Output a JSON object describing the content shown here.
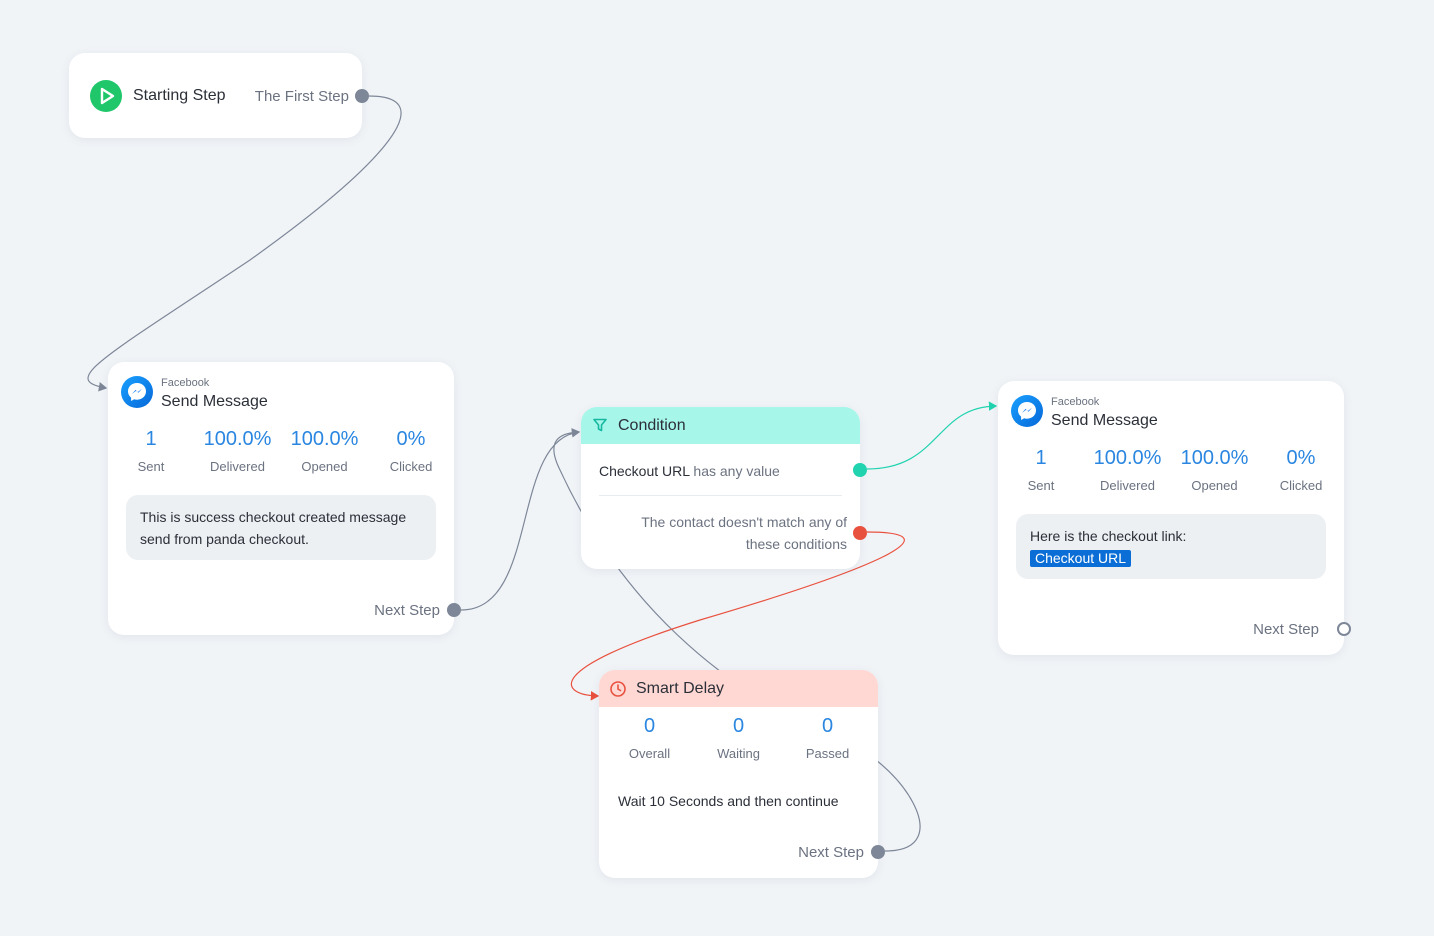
{
  "colors": {
    "canvas": "#f1f4f7",
    "stat_blue": "#2a86e0",
    "wire_gray": "#7d8798",
    "wire_green": "#22d3b0",
    "wire_red": "#e9513f",
    "condition_header": "#a6f6ea",
    "delay_header": "#ffd8d4",
    "start_icon": "#1fc76a",
    "link_chip": "#0a6ed6"
  },
  "start_step": {
    "icon": "play-icon",
    "title": "Starting Step",
    "next_label": "The First Step"
  },
  "message_1": {
    "icon": "messenger-icon",
    "platform": "Facebook",
    "title": "Send Message",
    "stats": [
      {
        "value": "1",
        "label": "Sent"
      },
      {
        "value": "100.0%",
        "label": "Delivered"
      },
      {
        "value": "100.0%",
        "label": "Opened"
      },
      {
        "value": "0%",
        "label": "Clicked"
      }
    ],
    "body": "This is success checkout created message send from panda checkout.",
    "next_label": "Next Step"
  },
  "condition": {
    "icon": "filter-icon",
    "title": "Condition",
    "field": "Checkout URL",
    "operator": "has any value",
    "fallback": "The contact doesn't match any of these conditions"
  },
  "delay": {
    "icon": "clock-icon",
    "title": "Smart Delay",
    "stats": [
      {
        "value": "0",
        "label": "Overall"
      },
      {
        "value": "0",
        "label": "Waiting"
      },
      {
        "value": "0",
        "label": "Passed"
      }
    ],
    "desc_prefix": "Wait",
    "desc_amount": "10 Seconds",
    "desc_suffix": "and then continue",
    "next_label": "Next Step"
  },
  "message_2": {
    "icon": "messenger-icon",
    "platform": "Facebook",
    "title": "Send Message",
    "stats": [
      {
        "value": "1",
        "label": "Sent"
      },
      {
        "value": "100.0%",
        "label": "Delivered"
      },
      {
        "value": "100.0%",
        "label": "Opened"
      },
      {
        "value": "0%",
        "label": "Clicked"
      }
    ],
    "body_text": "Here is the checkout link:",
    "link_chip": "Checkout URL",
    "next_label": "Next Step"
  }
}
